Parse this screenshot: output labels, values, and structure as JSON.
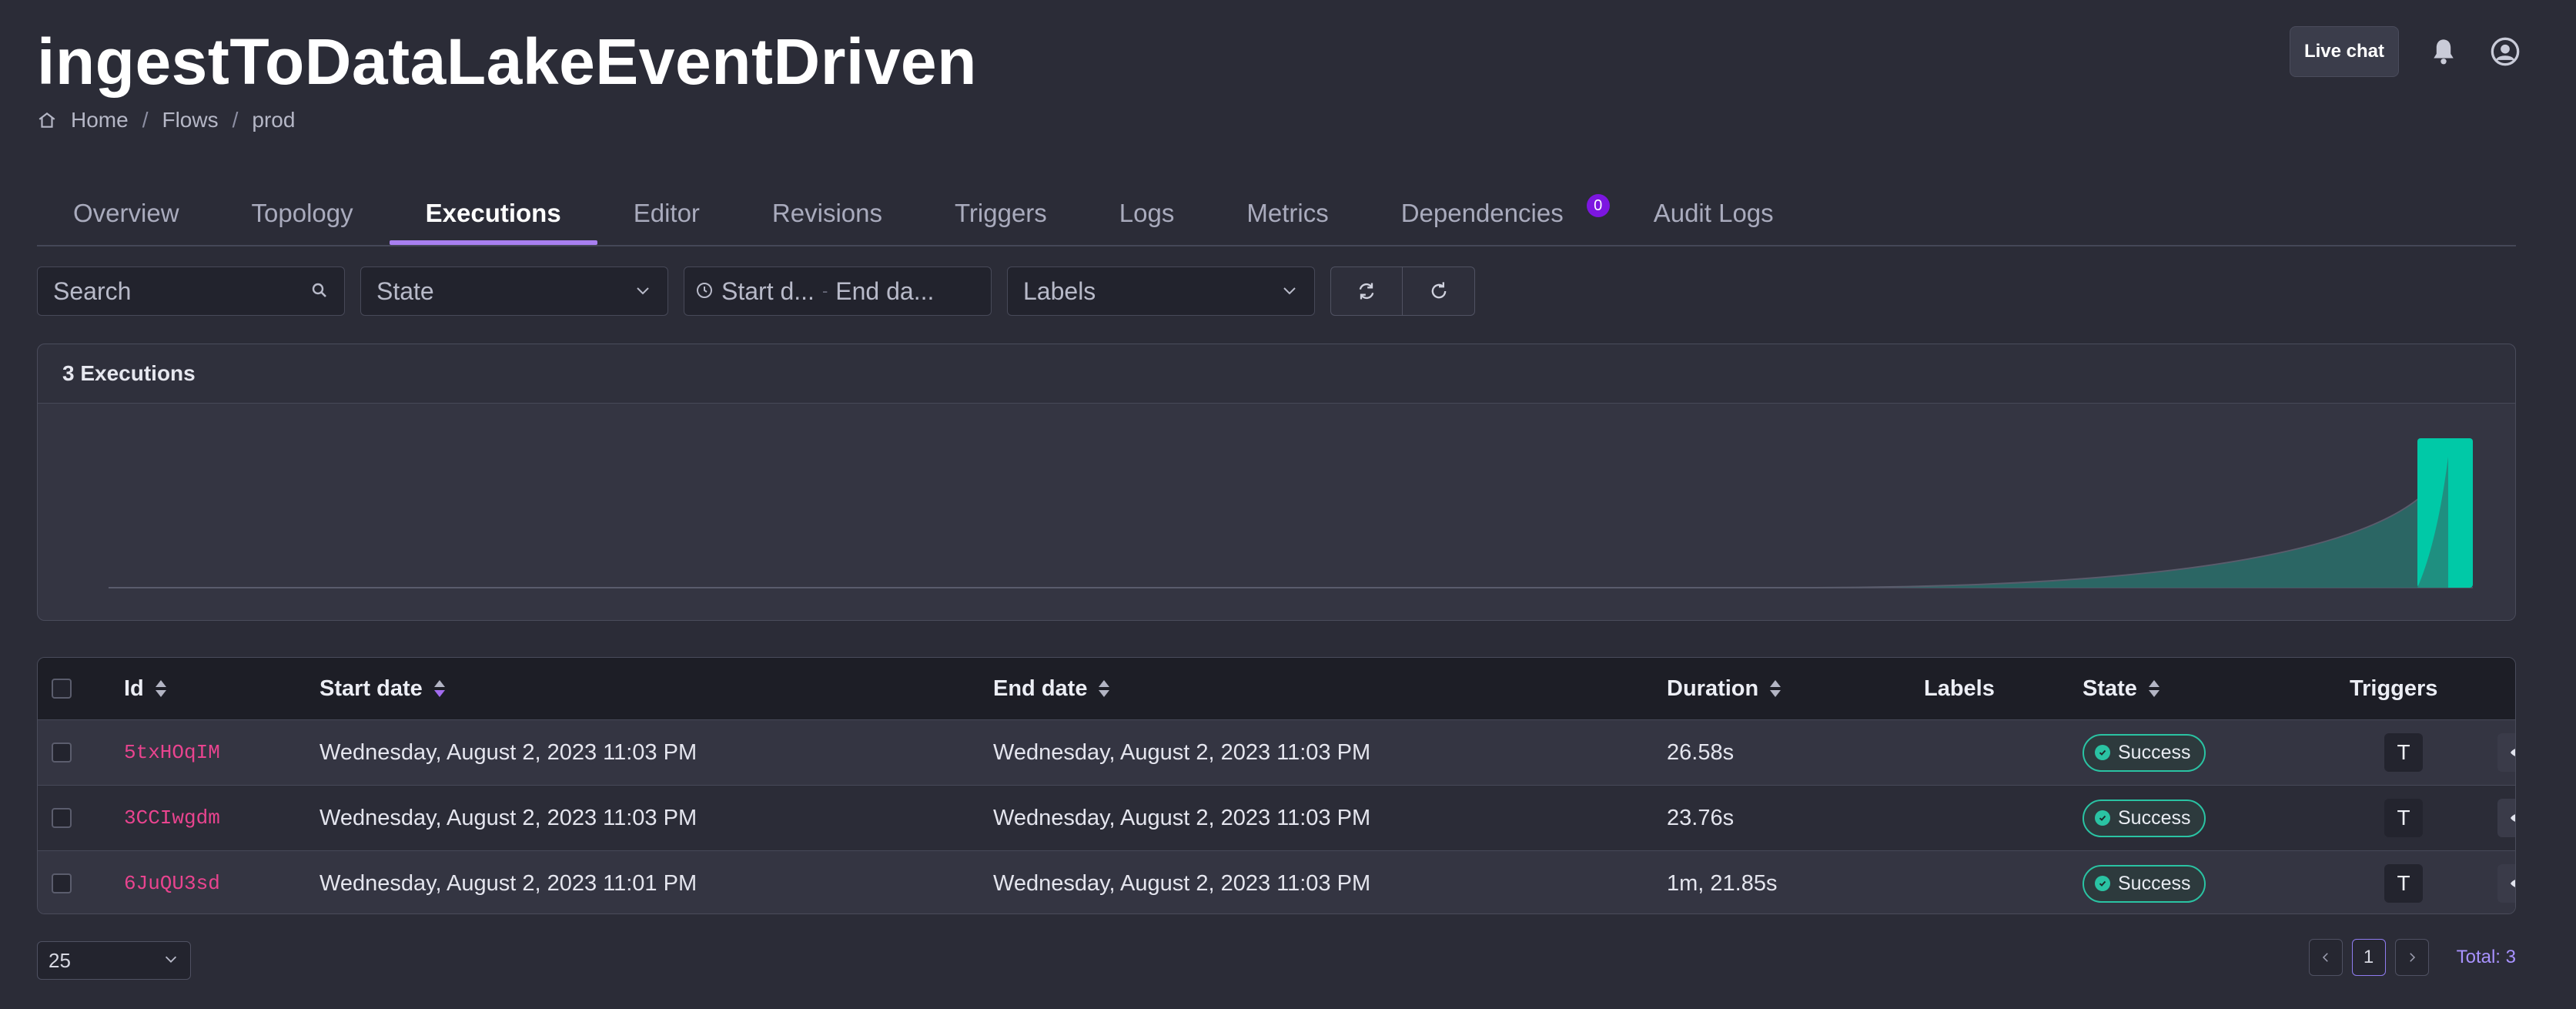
{
  "header": {
    "title": "ingestToDataLakeEventDriven",
    "breadcrumb": [
      "Home",
      "Flows",
      "prod"
    ],
    "live_chat_label": "Live chat",
    "icons": [
      "bell-icon",
      "account-icon"
    ]
  },
  "tabs": [
    {
      "label": "Overview",
      "active": false
    },
    {
      "label": "Topology",
      "active": false
    },
    {
      "label": "Executions",
      "active": true
    },
    {
      "label": "Editor",
      "active": false
    },
    {
      "label": "Revisions",
      "active": false
    },
    {
      "label": "Triggers",
      "active": false
    },
    {
      "label": "Logs",
      "active": false
    },
    {
      "label": "Metrics",
      "active": false
    },
    {
      "label": "Dependencies",
      "active": false,
      "badge": "0"
    },
    {
      "label": "Audit Logs",
      "active": false
    }
  ],
  "filters": {
    "search_placeholder": "Search",
    "state_placeholder": "State",
    "start_date_placeholder": "Start d...",
    "end_date_placeholder": "End da...",
    "labels_placeholder": "Labels"
  },
  "summary": {
    "title": "3 Executions"
  },
  "chart_data": {
    "type": "bar",
    "series": [
      {
        "values": [
          0,
          0,
          0,
          3
        ]
      }
    ],
    "ylim": [
      0,
      3
    ],
    "color": "#00c9a7",
    "grid": false
  },
  "table": {
    "columns": [
      "Id",
      "Start date",
      "End date",
      "Duration",
      "Labels",
      "State",
      "Triggers"
    ],
    "rows": [
      {
        "id": "5txHOqIM",
        "start": "Wednesday, August 2, 2023 11:03 PM",
        "end": "Wednesday, August 2, 2023 11:03 PM",
        "duration": "26.58s",
        "state": "Success",
        "trigger": "T"
      },
      {
        "id": "3CCIwgdm",
        "start": "Wednesday, August 2, 2023 11:03 PM",
        "end": "Wednesday, August 2, 2023 11:03 PM",
        "duration": "23.76s",
        "state": "Success",
        "trigger": "T"
      },
      {
        "id": "6JuQU3sd",
        "start": "Wednesday, August 2, 2023 11:01 PM",
        "end": "Wednesday, August 2, 2023 11:03 PM",
        "duration": "1m, 21.85s",
        "state": "Success",
        "trigger": "T"
      }
    ]
  },
  "pagination": {
    "page_size": "25",
    "current_page": "1",
    "total": "Total: 3"
  },
  "colors": {
    "accent": "#a87ff0",
    "success": "#2ac3a3",
    "id_text": "#e9448f",
    "badge": "#7c16e0"
  }
}
